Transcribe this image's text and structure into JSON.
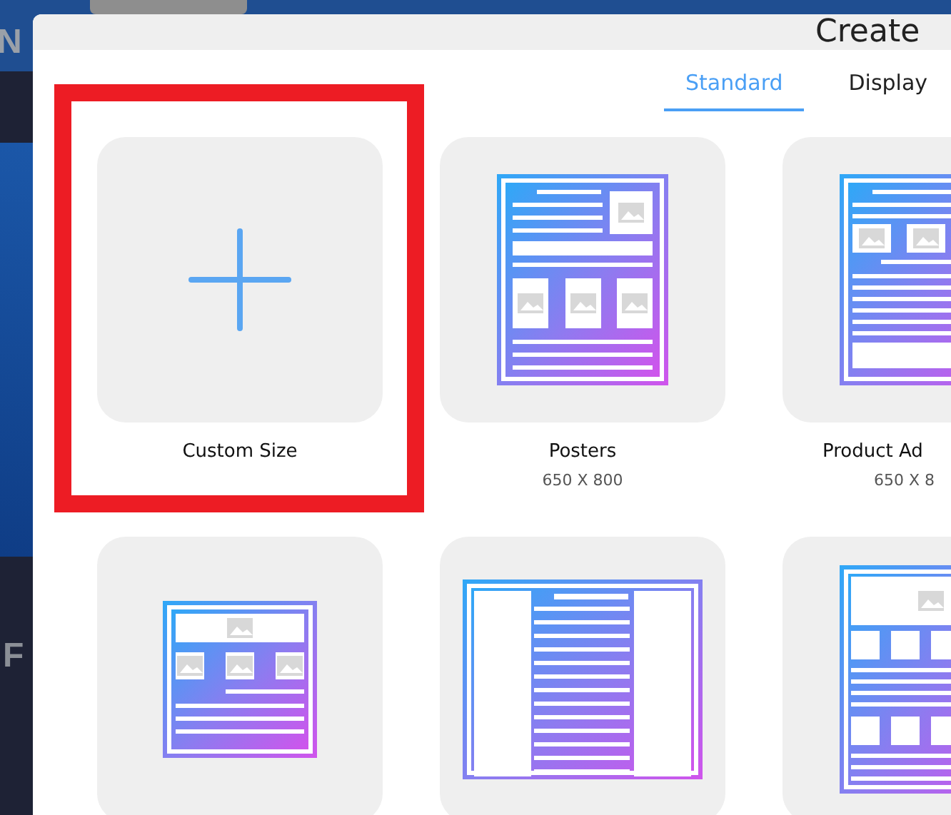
{
  "background": {
    "top_text": "N",
    "side_text": "F"
  },
  "dialog": {
    "title": "Create"
  },
  "tabs": [
    {
      "label": "Standard",
      "selected": true
    },
    {
      "label": "Display",
      "selected": false
    }
  ],
  "cards": [
    {
      "kind": "custom",
      "label": "Custom Size",
      "highlighted": true
    },
    {
      "kind": "poster",
      "label": "Posters",
      "size": "650 X 800",
      "highlighted": false
    },
    {
      "kind": "product-ad",
      "label": "Product Ad",
      "size": "650 X 8",
      "highlighted": false
    },
    {
      "kind": "flyer",
      "highlighted": false
    },
    {
      "kind": "article",
      "highlighted": false
    },
    {
      "kind": "catalog",
      "highlighted": false
    }
  ]
}
